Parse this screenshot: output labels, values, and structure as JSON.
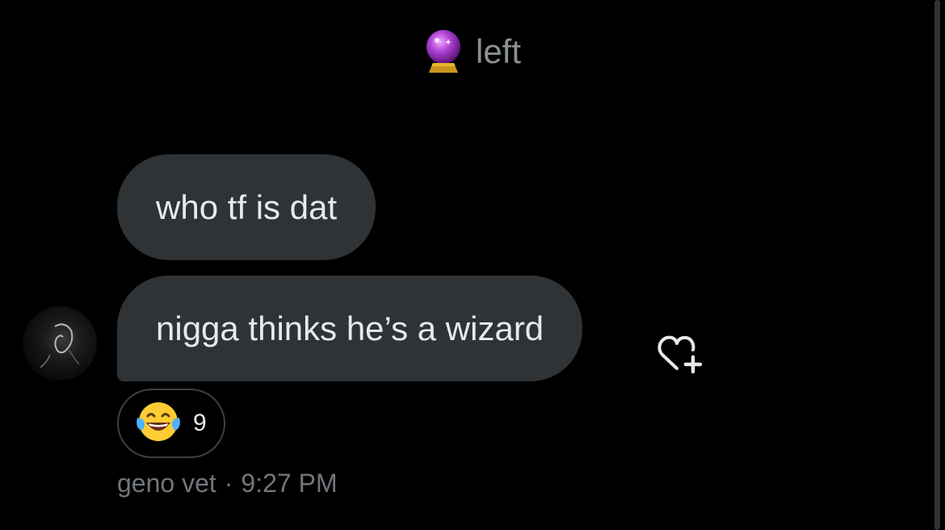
{
  "conversation": {
    "event": {
      "icon": "crystal-ball-icon",
      "text": "left"
    },
    "messages": [
      {
        "text": "who tf is dat"
      },
      {
        "text": "nigga thinks he’s a wizard"
      }
    ],
    "reaction": {
      "icon": "laughing-tears-emoji",
      "count": "9"
    },
    "meta": {
      "sender": "geno vet",
      "separator": "·",
      "time": "9:27 PM"
    }
  },
  "colors": {
    "background": "#000000",
    "bubble": "#2f3336",
    "text": "#e7e9ea",
    "muted": "#71767b"
  }
}
